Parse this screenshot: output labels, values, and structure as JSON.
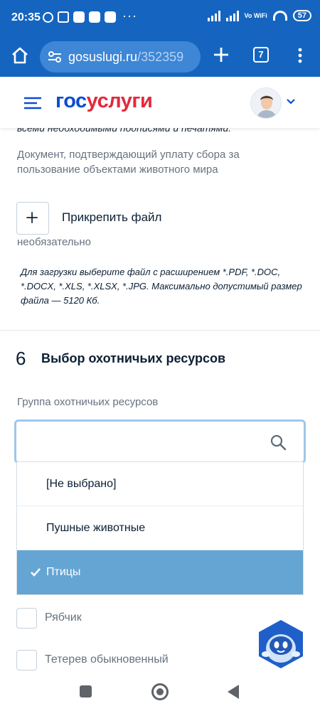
{
  "status_bar": {
    "time": "20:35",
    "more_indicator": "···",
    "network_label": "Vo WiFi",
    "battery": "57"
  },
  "browser": {
    "url_domain": "gosuslugi.ru",
    "url_path": "/352359",
    "tab_count": "7"
  },
  "header": {
    "logo_part1": "гос",
    "logo_part2": "услуги",
    "brand_blue": "#0d4cd3",
    "brand_red": "#e22a3c"
  },
  "content": {
    "cut_text": "всеми необходимыми подписями и печатями.",
    "document_description": "Документ, подтверждающий уплату сбора за пользование объектами животного мира",
    "attach_label": "Прикрепить файл",
    "optional_label": "необязательно",
    "upload_hint": "Для загрузки выберите файл с расширением *.PDF, *.DOC, *.DOCX, *.XLS, *.XLSX, *.JPG. Максимально допустимый размер файла — 5120 Кб."
  },
  "section": {
    "number": "6",
    "title": "Выбор охотничьих ресурсов",
    "group_label": "Группа охотничьих ресурсов",
    "search_value": "",
    "dropdown": {
      "options": [
        "[Не выбрано]",
        "Пушные животные",
        "Птицы"
      ],
      "selected": "Птицы",
      "selected_color": "#65a5d3"
    },
    "checkboxes": [
      {
        "label": "Рябчик",
        "checked": false
      },
      {
        "label": "Тетерев обыкновенный",
        "checked": false
      }
    ]
  }
}
